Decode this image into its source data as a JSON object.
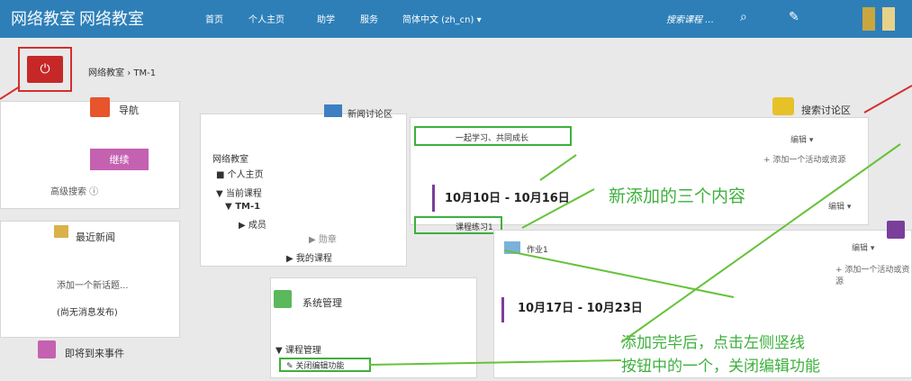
{
  "header": {
    "brand": "网络教室",
    "brand2": "网络教室",
    "nav": [
      "首页",
      "个人主页",
      "助学",
      "服务",
      "简体中文 (zh_cn)"
    ],
    "search_placeholder": "搜索课程 …"
  },
  "breadcrumb": {
    "root": "网络教室",
    "sep": "›",
    "current": "TM-1"
  },
  "left_column": {
    "nav_block_title": "导航",
    "continue_button": "继续",
    "adv_search": "高级搜索",
    "news_block_title": "最近新闻",
    "add_news": "添加一个新话题...",
    "no_news": "(尚无消息发布)",
    "events_title": "即将到来事件"
  },
  "nav_tree": {
    "root": "网络教室",
    "items": [
      {
        "label": "个人主页",
        "indent": 1,
        "marker": "■"
      },
      {
        "label": "当前课程",
        "indent": 1,
        "marker": "▼"
      },
      {
        "label": "TM-1",
        "indent": 2,
        "marker": "▼"
      },
      {
        "label": "成员",
        "indent": 3,
        "marker": "▶"
      },
      {
        "label": "勋章",
        "indent": 3,
        "marker": "▶"
      },
      {
        "label": "我的课程",
        "indent": 2,
        "marker": "▶"
      }
    ]
  },
  "admin_block": {
    "title": "系统管理",
    "course_admin": "课程管理",
    "turn_off_editing": "关闭编辑功能"
  },
  "main": {
    "news_forum": "新闻讨论区",
    "learn_together": "一起学习、共同成长",
    "add_resource": "+ 添加一个活动或资源",
    "edit": "编辑",
    "week1": "10月10日 - 10月16日",
    "homework": "课程练习1",
    "week2": "10月17日 - 10月23日",
    "homework2": "作业1",
    "search_forum": "搜索讨论区"
  },
  "annotations": {
    "new_three": "新添加的三个内容",
    "after_add_1": "添加完毕后，点击左侧竖线",
    "after_add_2": "按钮中的一个，关闭编辑功能"
  },
  "colors": {
    "topbar": "#2e7fb8",
    "red": "#d32f2f",
    "annotation_green": "#3db03d",
    "purple": "#7a3e9b",
    "pink_button": "#c561b1"
  }
}
